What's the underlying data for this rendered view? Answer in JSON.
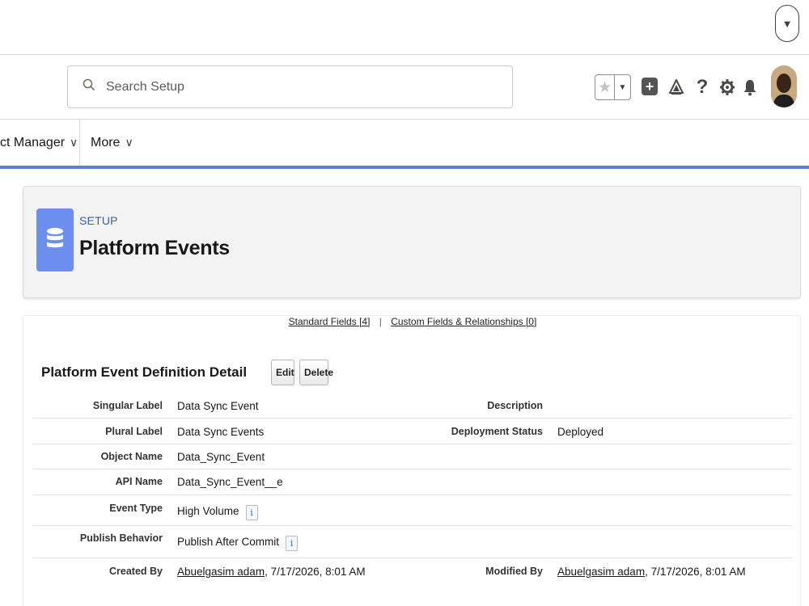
{
  "colors": {
    "accent": "#5f7ed8",
    "page_icon": "#6b8eef",
    "breadcrumb": "#3a5ea8"
  },
  "top": {
    "user_menu_caret": "▼"
  },
  "header": {
    "search": {
      "placeholder": "Search Setup",
      "icon": "search-icon"
    },
    "icons": [
      "favorites-star-icon",
      "chevron-down-icon",
      "add-icon",
      "trailhead-icon",
      "help-icon",
      "gear-icon",
      "bell-icon",
      "avatar"
    ]
  },
  "nav": {
    "items": [
      {
        "label": "ct Manager",
        "caret": "∨"
      },
      {
        "label": "More",
        "caret": "∨"
      }
    ]
  },
  "page_header": {
    "breadcrumb": "SETUP",
    "title": "Platform Events",
    "icon": "database-icon"
  },
  "related_links": {
    "standard": "Standard Fields",
    "standard_count": "[4]",
    "custom": "Custom Fields & Relationships",
    "custom_count": "[0]",
    "separator": "|"
  },
  "detail": {
    "section_title": "Platform Event Definition Detail",
    "edit_label": "Edit",
    "delete_label": "Delete",
    "rows": [
      {
        "label": "Singular Label",
        "value": "Data Sync Event",
        "right_label": "Description",
        "right_value": ""
      },
      {
        "label": "Plural Label",
        "value": "Data Sync Events",
        "right_label": "Deployment Status",
        "right_value": "Deployed"
      },
      {
        "label": "Object Name",
        "value": "Data_Sync_Event"
      },
      {
        "label": "API Name",
        "value": "Data_Sync_Event__e"
      },
      {
        "label": "Event Type",
        "value": "High Volume",
        "info": "i"
      },
      {
        "label": "Publish Behavior",
        "value": "Publish After Commit",
        "info": "i"
      },
      {
        "label": "Created By",
        "user": "Abuelgasim adam",
        "date": ", 7/17/2026, 8:01 AM",
        "right_label": "Modified By",
        "right_user": "Abuelgasim adam",
        "right_date": ", 7/17/2026, 8:01 AM"
      }
    ]
  }
}
